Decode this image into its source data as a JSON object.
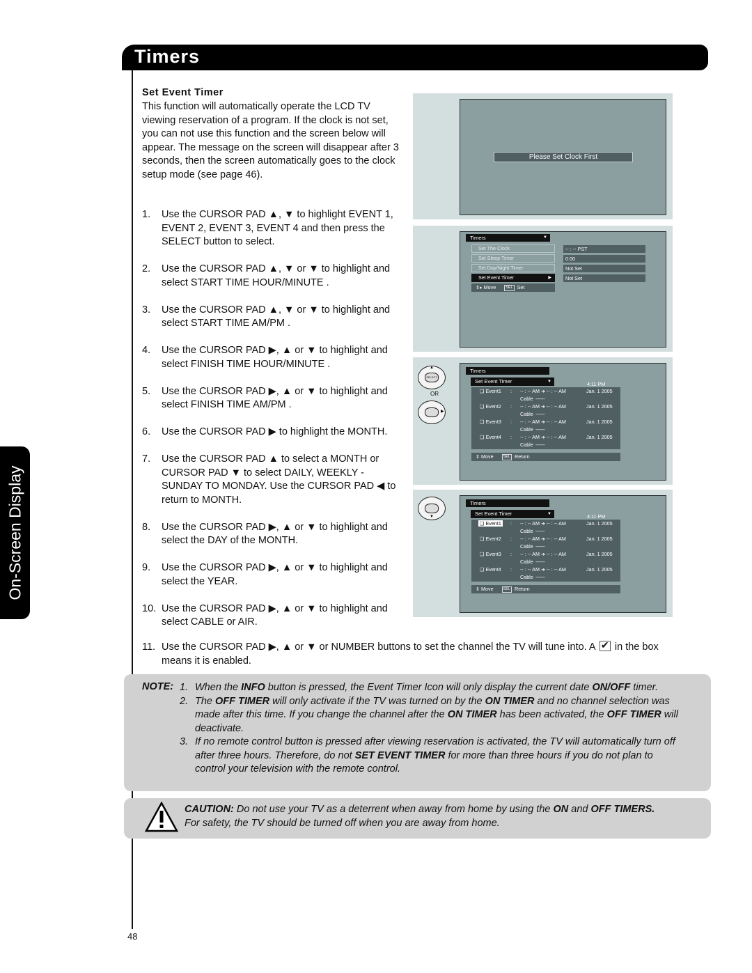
{
  "header": {
    "title": "Timers"
  },
  "side_tab": {
    "label": "On-Screen Display"
  },
  "section": {
    "heading": "Set Event Timer",
    "intro": "This function will automatically operate the LCD TV viewing reservation of a program. If the clock is not set, you can not use this function and the screen below will appear. The message on the screen will disappear after 3 seconds, then the screen automatically goes to the clock setup mode (see page 46)."
  },
  "steps": [
    {
      "num": "1.",
      "text": "Use the CURSOR PAD ▲, ▼ to highlight EVENT 1, EVENT 2, EVENT 3, EVENT 4 and then press the SELECT button to select."
    },
    {
      "num": "2.",
      "text": "Use the CURSOR PAD ▲, ▼ or ▼ to highlight and select START TIME HOUR/MINUTE ."
    },
    {
      "num": "3.",
      "text": "Use the CURSOR PAD ▲, ▼ or ▼ to highlight and select START TIME AM/PM ."
    },
    {
      "num": "4.",
      "text": "Use the CURSOR PAD ▶, ▲ or ▼ to highlight and select FINISH TIME HOUR/MINUTE ."
    },
    {
      "num": "5.",
      "text": "Use the CURSOR PAD ▶, ▲ or ▼ to highlight and select FINISH TIME AM/PM ."
    },
    {
      "num": "6.",
      "text": "Use the CURSOR PAD ▶ to highlight the MONTH."
    },
    {
      "num": "7.",
      "text": "Use the CURSOR PAD ▲ to select a MONTH or CURSOR PAD ▼ to select DAILY, WEEKLY - SUNDAY TO MONDAY. Use the CURSOR PAD ◀ to return to MONTH."
    },
    {
      "num": "8.",
      "text": "Use the CURSOR PAD ▶, ▲ or ▼ to highlight and select the DAY of the MONTH."
    },
    {
      "num": "9.",
      "text": "Use the CURSOR PAD ▶, ▲ or ▼ to highlight and select the YEAR."
    },
    {
      "num": "10.",
      "text": "Use the CURSOR PAD ▶, ▲ or ▼ to highlight and select CABLE or AIR."
    }
  ],
  "step11": {
    "num": "11.",
    "before": "Use the CURSOR PAD ▶, ▲ or ▼ or NUMBER buttons to set the channel the TV will tune into. A",
    "after": "in the box means it is enabled."
  },
  "screen1": {
    "message": "Please Set Clock First"
  },
  "screen2": {
    "menu_title": "Timers",
    "items": [
      {
        "label": "Set The Clock",
        "value": "-- : --  PST"
      },
      {
        "label": "Set Sleep Timer",
        "value": "0:00"
      },
      {
        "label": "Set Day/Night Timer",
        "value": "Not Set"
      },
      {
        "label": "Set Event Timer",
        "value": "Not Set",
        "selected": true
      }
    ],
    "help_move": "Move",
    "help_sel": "SEL",
    "help_action": "Set"
  },
  "screen3": {
    "menu_title": "Timers",
    "submenu_title": "Set Event Timer",
    "clock": "4:11 PM",
    "or_label": "OR",
    "events": [
      {
        "name": "❑ Event1",
        "time": "-- : -- AM  ➜ -- : -- AM",
        "date": "Jan. 1 2005",
        "source": "Cable",
        "channel": "-------"
      },
      {
        "name": "❑ Event2",
        "time": "-- : -- AM  ➜ -- : -- AM",
        "date": "Jan. 1 2005",
        "source": "Cable",
        "channel": "-------"
      },
      {
        "name": "❑ Event3",
        "time": "-- : -- AM  ➜ -- : -- AM",
        "date": "Jan. 1 2005",
        "source": "Cable",
        "channel": "-------"
      },
      {
        "name": "❑ Event4",
        "time": "-- : -- AM  ➜ -- : -- AM",
        "date": "Jan. 1 2005",
        "source": "Cable",
        "channel": "-------"
      }
    ],
    "help_move": "Move",
    "help_sel": "SEL",
    "help_action": "Return"
  },
  "screen4": {
    "menu_title": "Timers",
    "submenu_title": "Set Event Timer",
    "clock": "4:11 PM",
    "highlighted_event": "Event1",
    "events": [
      {
        "name": "❑ Event1",
        "time": "-- : -- AM  ➜ -- : -- AM",
        "date": "Jan. 1 2005",
        "source": "Cable",
        "channel": "-------"
      },
      {
        "name": "❑ Event2",
        "time": "-- : -- AM  ➜ -- : -- AM",
        "date": "Jan. 1 2005",
        "source": "Cable",
        "channel": "-------"
      },
      {
        "name": "❑ Event3",
        "time": "-- : -- AM  ➜ -- : -- AM",
        "date": "Jan. 1 2005",
        "source": "Cable",
        "channel": "-------"
      },
      {
        "name": "❑ Event4",
        "time": "-- : -- AM  ➜ -- : -- AM",
        "date": "Jan. 1 2005",
        "source": "Cable",
        "channel": "-------"
      }
    ],
    "help_move": "Move",
    "help_sel": "SEL",
    "help_action": "Return"
  },
  "note": {
    "label": "NOTE:",
    "items": [
      {
        "num": "1.",
        "parts": [
          [
            "When the ",
            false
          ],
          [
            "INFO",
            true
          ],
          [
            " button is pressed, the Event Timer Icon will only display the current date ",
            false
          ],
          [
            "ON/OFF",
            true
          ],
          [
            " timer.",
            false
          ]
        ]
      },
      {
        "num": "2.",
        "parts": [
          [
            "The ",
            false
          ],
          [
            "OFF TIMER",
            true
          ],
          [
            " will only activate if the TV was turned on by the ",
            false
          ],
          [
            "ON TIMER",
            true
          ],
          [
            " and no channel selection was made after this time. If you change the channel after the ",
            false
          ],
          [
            "ON TIMER",
            true
          ],
          [
            " has been activated, the ",
            false
          ],
          [
            "OFF TIMER",
            true
          ],
          [
            " will deactivate.",
            false
          ]
        ]
      },
      {
        "num": "3.",
        "parts": [
          [
            "If no remote control button is pressed after viewing reservation is activated, the TV will automatically turn off after three hours. Therefore, do not ",
            false
          ],
          [
            "SET EVENT TIMER",
            true
          ],
          [
            " for more than three hours if you do not plan to control your television with the remote control.",
            false
          ]
        ]
      }
    ]
  },
  "caution": {
    "parts": [
      [
        "CAUTION:",
        true
      ],
      [
        " Do not use your TV as a deterrent when away from home by using the ",
        false
      ],
      [
        "ON",
        true
      ],
      [
        " and ",
        false
      ],
      [
        "OFF TIMERS.",
        true
      ],
      [
        " For safety, the TV should be turned off when you are away from home.",
        false
      ]
    ]
  },
  "page_number": "48",
  "colors": {
    "panel_bg": "#d3dfde",
    "screen_bg": "#8b9ea0",
    "osd_dark": "#4f5f62",
    "note_bg": "#d1d1d1"
  }
}
